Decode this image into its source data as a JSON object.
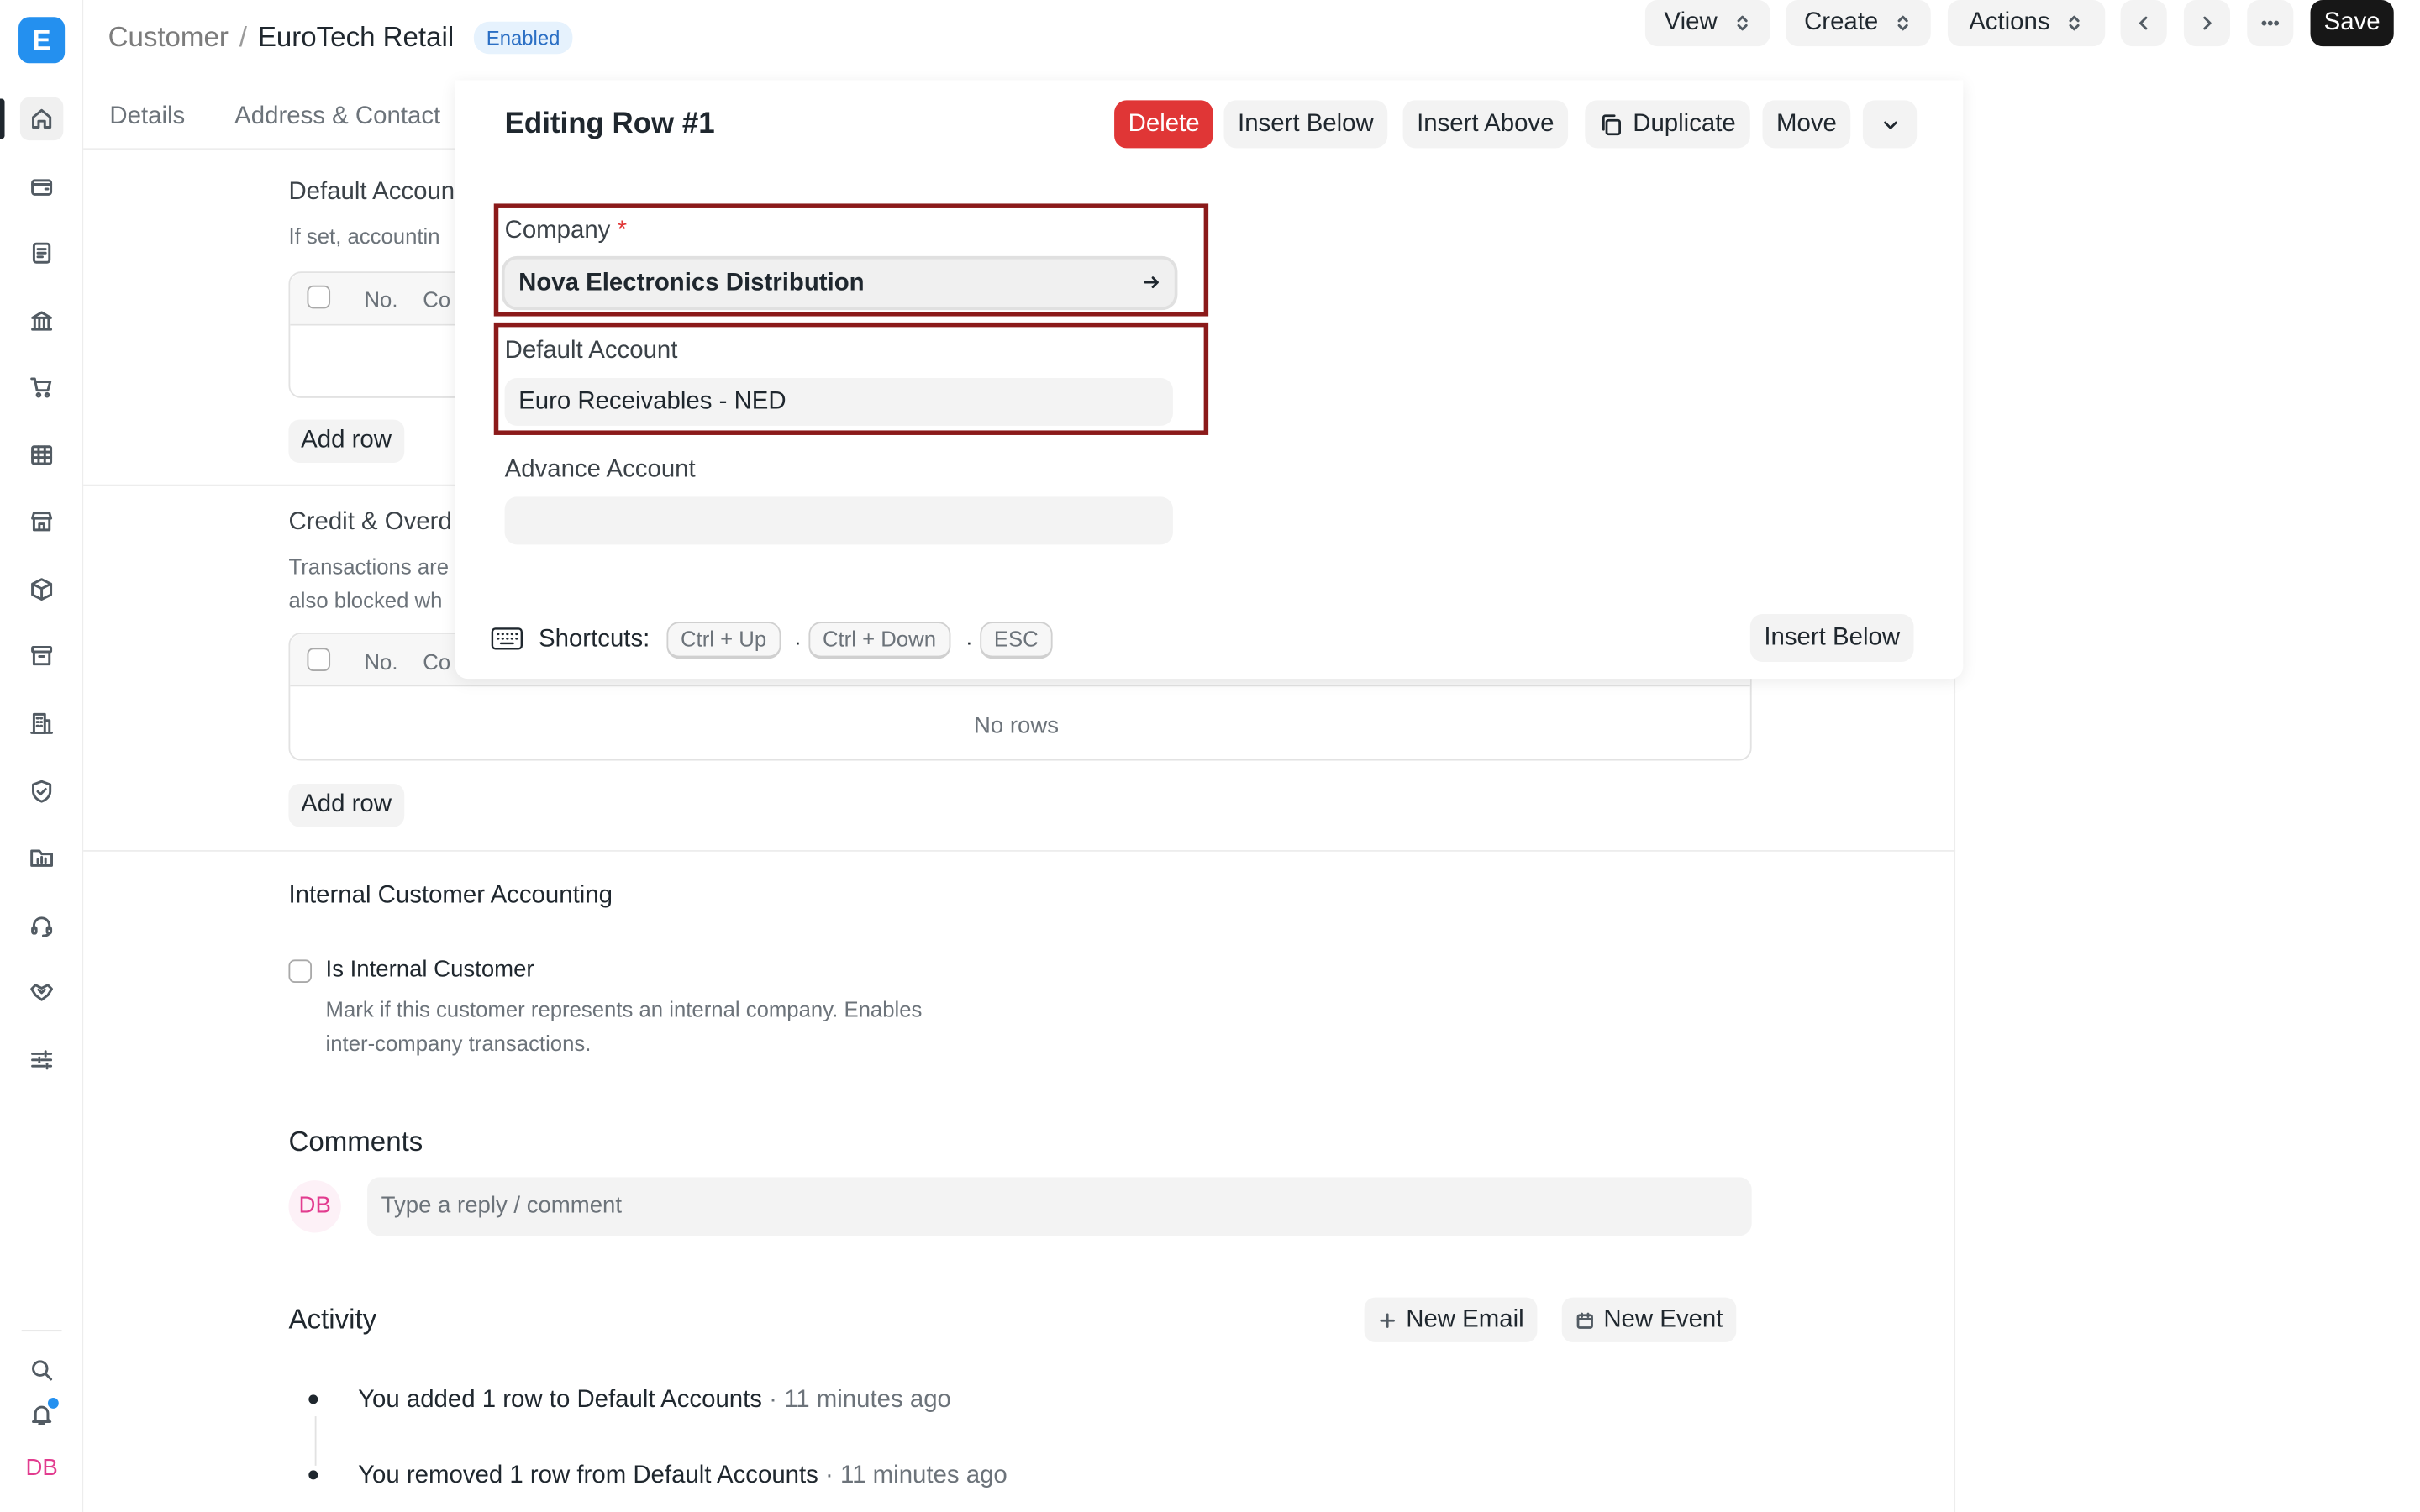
{
  "app": {
    "logo_letter": "E",
    "user_initials": "DB"
  },
  "header": {
    "breadcrumb_parent": "Customer",
    "breadcrumb_separator": "/",
    "breadcrumb_current": "EuroTech Retail",
    "status_badge": "Enabled",
    "view_label": "View",
    "create_label": "Create",
    "actions_label": "Actions",
    "save_label": "Save"
  },
  "tabs": [
    "Details",
    "Address & Contact"
  ],
  "sidebar": {
    "icons": [
      "home-icon",
      "wallet-icon",
      "document-icon",
      "bank-icon",
      "cart-icon",
      "table-icon",
      "store-icon",
      "package-icon",
      "archive-icon",
      "building-icon",
      "shield-icon",
      "folder-chart-icon",
      "headset-icon",
      "handshake-icon",
      "sliders-icon"
    ],
    "bottom_icons": [
      "search-icon",
      "bell-icon"
    ]
  },
  "default_accounts": {
    "title": "Default Accoun",
    "description": "If set, accountin",
    "col_no": "No.",
    "col_co": "Co",
    "add_row": "Add row"
  },
  "credit_limits": {
    "title": "Credit & Overd",
    "description_line1": "Transactions are",
    "description_line2": "also blocked wh",
    "col_no": "No.",
    "col_co": "Co",
    "empty": "No rows",
    "add_row": "Add row"
  },
  "internal": {
    "title": "Internal Customer Accounting",
    "checkbox_label": "Is Internal Customer",
    "help_line1": "Mark if this customer represents an internal company. Enables",
    "help_line2": "inter-company transactions."
  },
  "dialog": {
    "title": "Editing Row #1",
    "delete": "Delete",
    "insert_below": "Insert Below",
    "insert_above": "Insert Above",
    "duplicate": "Duplicate",
    "move": "Move",
    "company_label": "Company",
    "required_mark": "*",
    "company_value": "Nova Electronics Distribution",
    "default_account_label": "Default Account",
    "default_account_value": "Euro Receivables - NED",
    "advance_account_label": "Advance Account",
    "advance_account_value": "",
    "shortcuts_label": "Shortcuts:",
    "shortcut_1": "Ctrl + Up",
    "shortcut_2": "Ctrl + Down",
    "shortcut_3": "ESC",
    "dot": ".",
    "footer_insert_below": "Insert Below"
  },
  "comments": {
    "title": "Comments",
    "placeholder": "Type a reply / comment",
    "avatar": "DB"
  },
  "activity": {
    "title": "Activity",
    "new_email": "New Email",
    "new_event": "New Event",
    "items": [
      {
        "text": "You added 1 row to Default Accounts",
        "time": "· 11 minutes ago"
      },
      {
        "text": "You removed 1 row from Default Accounts",
        "time": "· 11 minutes ago"
      }
    ]
  }
}
